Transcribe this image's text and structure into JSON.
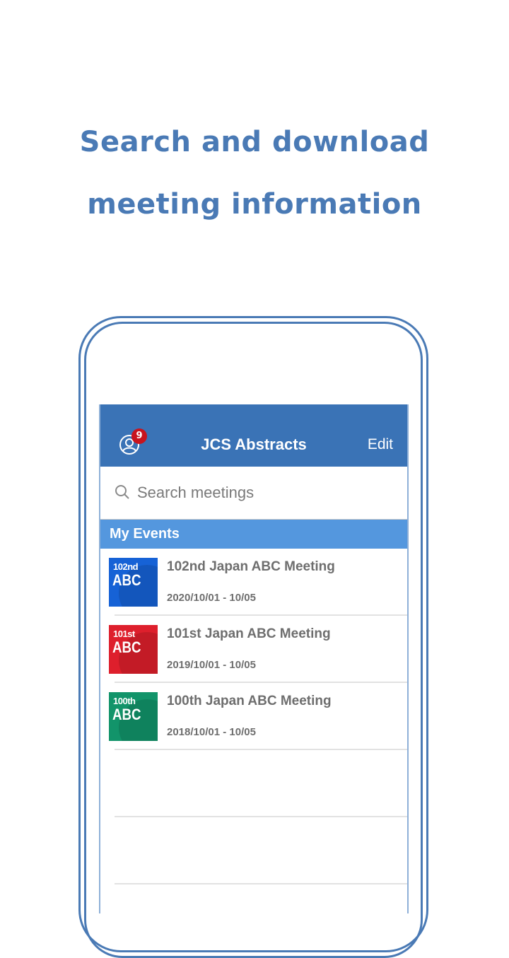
{
  "headline": {
    "line1": "Search and download",
    "line2": "meeting information"
  },
  "app": {
    "title": "JCS Abstracts",
    "edit_label": "Edit",
    "notification_count": "9",
    "accent_color": "#3a73b6",
    "section_color": "#5497de"
  },
  "search": {
    "placeholder": "Search meetings",
    "value": ""
  },
  "section": {
    "title": "My Events"
  },
  "events": [
    {
      "ordinal": "102nd",
      "abbr": "ABC",
      "title": "102nd Japan ABC Meeting",
      "dates": "2020/10/01 - 10/05",
      "color": "#1662d6"
    },
    {
      "ordinal": "101st",
      "abbr": "ABC",
      "title": "101st Japan ABC Meeting",
      "dates": "2019/10/01 - 10/05",
      "color": "#de1f2c"
    },
    {
      "ordinal": "100th",
      "abbr": "ABC",
      "title": "100th Japan ABC Meeting",
      "dates": "2018/10/01 - 10/05",
      "color": "#12946a"
    }
  ]
}
